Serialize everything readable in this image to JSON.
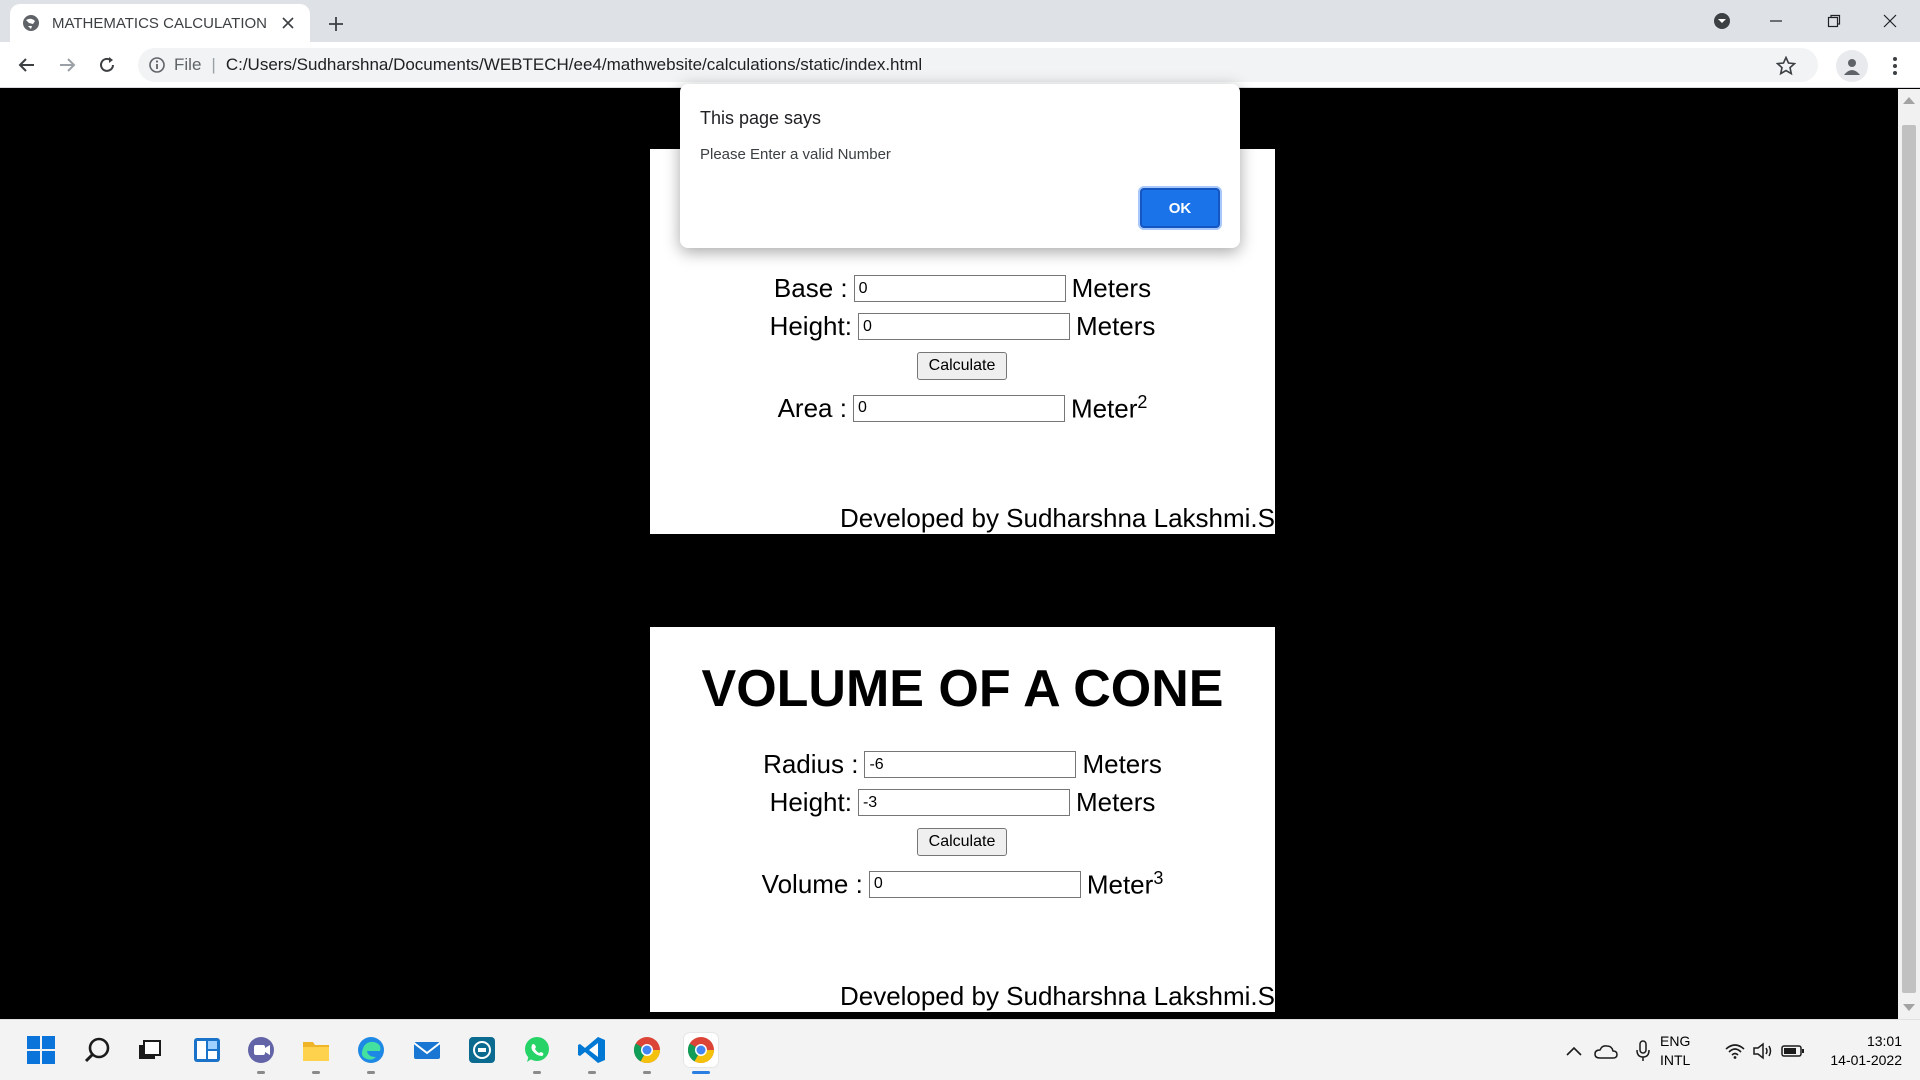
{
  "browser": {
    "tab_title": "MATHEMATICS CALCULATION",
    "url_scheme": "File",
    "url": "C:/Users/Sudharshna/Documents/WEBTECH/ee4/mathwebsite/calculations/static/index.html"
  },
  "area_card": {
    "base_label": "Base :",
    "base_value": "0",
    "base_unit": "Meters",
    "height_label": "Height:",
    "height_value": "0",
    "height_unit": "Meters",
    "calculate_label": "Calculate",
    "result_label": "Area :",
    "result_value": "0",
    "result_unit": "Meter",
    "result_unit_power": "2",
    "credit": "Developed by Sudharshna Lakshmi.S"
  },
  "cone_card": {
    "title": "VOLUME OF A CONE",
    "radius_label": "Radius :",
    "radius_value": "-6",
    "radius_unit": "Meters",
    "height_label": "Height:",
    "height_value": "-3",
    "height_unit": "Meters",
    "calculate_label": "Calculate",
    "result_label": "Volume :",
    "result_value": "0",
    "result_unit": "Meter",
    "result_unit_power": "3",
    "credit": "Developed by Sudharshna Lakshmi.S"
  },
  "dialog": {
    "title": "This page says",
    "message": "Please Enter a valid Number",
    "ok_label": "OK"
  },
  "taskbar": {
    "lang_top": "ENG",
    "lang_bottom": "INTL",
    "time": "13:01",
    "date": "14-01-2022"
  },
  "colors": {
    "dialog_button": "#1a73e8",
    "page_background": "#000000",
    "card_background": "#ffffff"
  }
}
